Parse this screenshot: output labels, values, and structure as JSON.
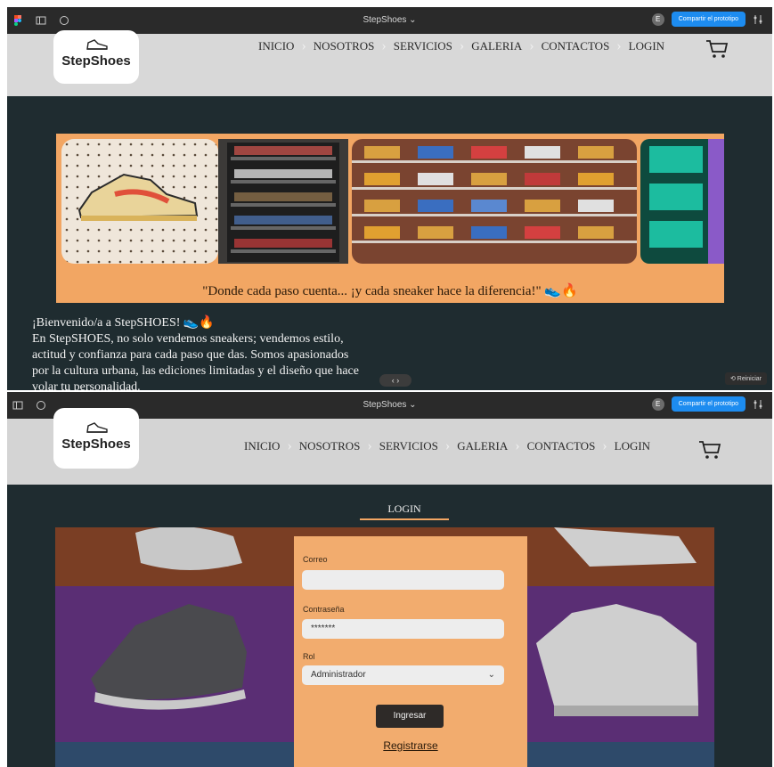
{
  "screens": [
    {
      "topbar": {
        "title": "StepShoes ⌄",
        "avatar": "E",
        "share_label": "Compartir el prototipo"
      },
      "logo": {
        "text": "StepShoes"
      },
      "menu": [
        "INICIO",
        "NOSOTROS",
        "SERVICIOS",
        "GALERIA",
        "CONTACTOS",
        "LOGIN"
      ],
      "banner": {
        "quote": "\"Donde cada paso cuenta... ¡y cada sneaker hace la diferencia!\" 👟🔥"
      },
      "welcome": [
        "¡Bienvenido/a a StepSHOES! 👟🔥",
        "En StepSHOES, no solo vendemos sneakers; vendemos estilo,",
        "actitud y confianza para cada paso que das. Somos apasionados",
        "por la cultura urbana, las ediciones limitadas y el diseño que hace",
        "volar tu personalidad."
      ],
      "reset_label": "⟲ Reiniciar",
      "carousel_label": "‹ ›"
    },
    {
      "topbar": {
        "title": "StepShoes ⌄",
        "avatar": "E",
        "share_label": "Compartir el prototipo"
      },
      "logo": {
        "text": "StepShoes"
      },
      "menu": [
        "INICIO",
        "NOSOTROS",
        "SERVICIOS",
        "GALERIA",
        "CONTACTOS",
        "LOGIN"
      ],
      "login": {
        "heading": "LOGIN",
        "email_label": "Correo",
        "email_value": "",
        "password_label": "Contraseña",
        "password_value": "*******",
        "role_label": "Rol",
        "role_value": "Administrador",
        "submit_label": "Ingresar",
        "register_label": "Registrarse"
      }
    }
  ],
  "colors": {
    "accent": "#f2a663",
    "dark_bg": "#1f2c30",
    "share_blue": "#1d8cf0"
  },
  "icons": [
    "figma-icon",
    "sidebar-icon",
    "comment-icon",
    "cart-icon",
    "shoe-logo-icon",
    "settings-sliders-icon"
  ]
}
